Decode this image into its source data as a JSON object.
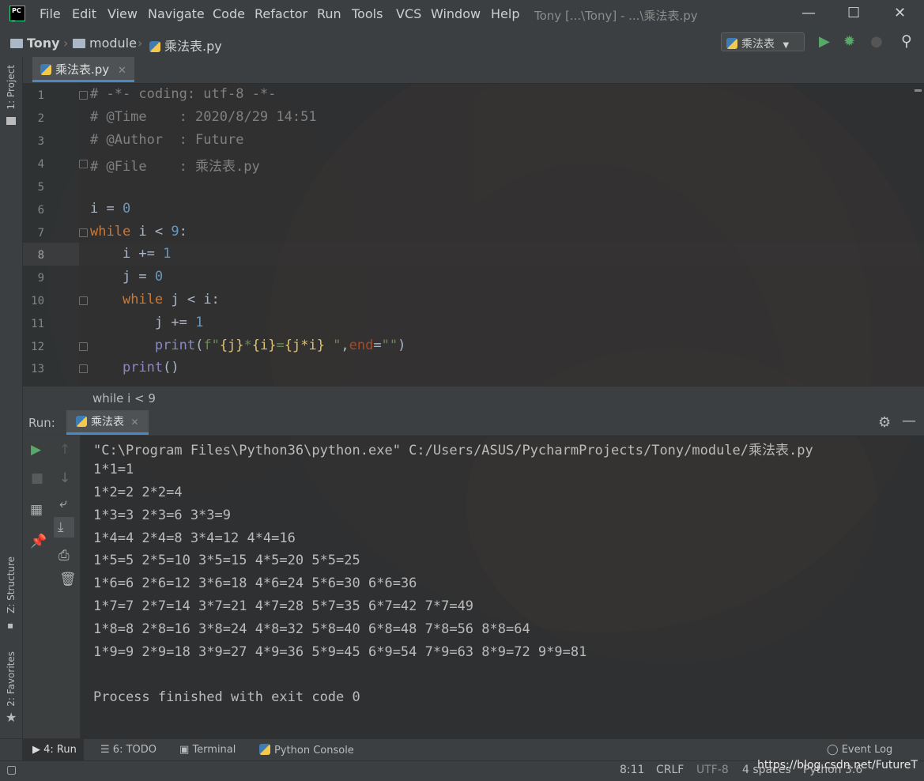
{
  "window": {
    "title": "Tony [...\\Tony] - ...\\乘法表.py",
    "menu": [
      "File",
      "Edit",
      "View",
      "Navigate",
      "Code",
      "Refactor",
      "Run",
      "Tools",
      "VCS",
      "Window",
      "Help"
    ]
  },
  "navbar": {
    "crumbs": [
      "Tony",
      "module",
      "乘法表.py"
    ],
    "run_config": "乘法表"
  },
  "left_strip": {
    "project": "1: Project",
    "structure": "Z: Structure",
    "favorites": "2: Favorites"
  },
  "editor": {
    "tab": "乘法表.py",
    "line_numbers": [
      "1",
      "2",
      "3",
      "4",
      "5",
      "6",
      "7",
      "8",
      "9",
      "10",
      "11",
      "12",
      "13"
    ],
    "lines": [
      "# -*- coding: utf-8 -*-",
      "# @Time    : 2020/8/29 14:51",
      "# @Author  : Future",
      "# @File    : 乘法表.py",
      "",
      "i = 0",
      "while i < 9:",
      "    i += 1",
      "    j = 0",
      "    while j < i:",
      "        j += 1",
      "        print(f\"{j}*{i}={j*i} \",end=\"\")",
      "    print()"
    ],
    "breadcrumb": "while i < 9"
  },
  "run": {
    "label": "Run:",
    "tab": "乘法表",
    "output": [
      "\"C:\\Program Files\\Python36\\python.exe\" C:/Users/ASUS/PycharmProjects/Tony/module/乘法表.py",
      "1*1=1",
      "1*2=2 2*2=4",
      "1*3=3 2*3=6 3*3=9",
      "1*4=4 2*4=8 3*4=12 4*4=16",
      "1*5=5 2*5=10 3*5=15 4*5=20 5*5=25",
      "1*6=6 2*6=12 3*6=18 4*6=24 5*6=30 6*6=36",
      "1*7=7 2*7=14 3*7=21 4*7=28 5*7=35 6*7=42 7*7=49",
      "1*8=8 2*8=16 3*8=24 4*8=32 5*8=40 6*8=48 7*8=56 8*8=64",
      "1*9=9 2*9=18 3*9=27 4*9=36 5*9=45 6*9=54 7*9=63 8*9=72 9*9=81",
      "",
      "Process finished with exit code 0"
    ]
  },
  "bottom_tabs": {
    "run": "4: Run",
    "todo": "6: TODO",
    "terminal": "Terminal",
    "python_console": "Python Console",
    "event_log": "Event Log"
  },
  "status": {
    "position": "8:11",
    "line_sep": "CRLF",
    "encoding": "UTF-8",
    "indent": "4 spaces",
    "interpreter": "Python 3.6",
    "watermark": "https://blog.csdn.net/FutureT"
  }
}
